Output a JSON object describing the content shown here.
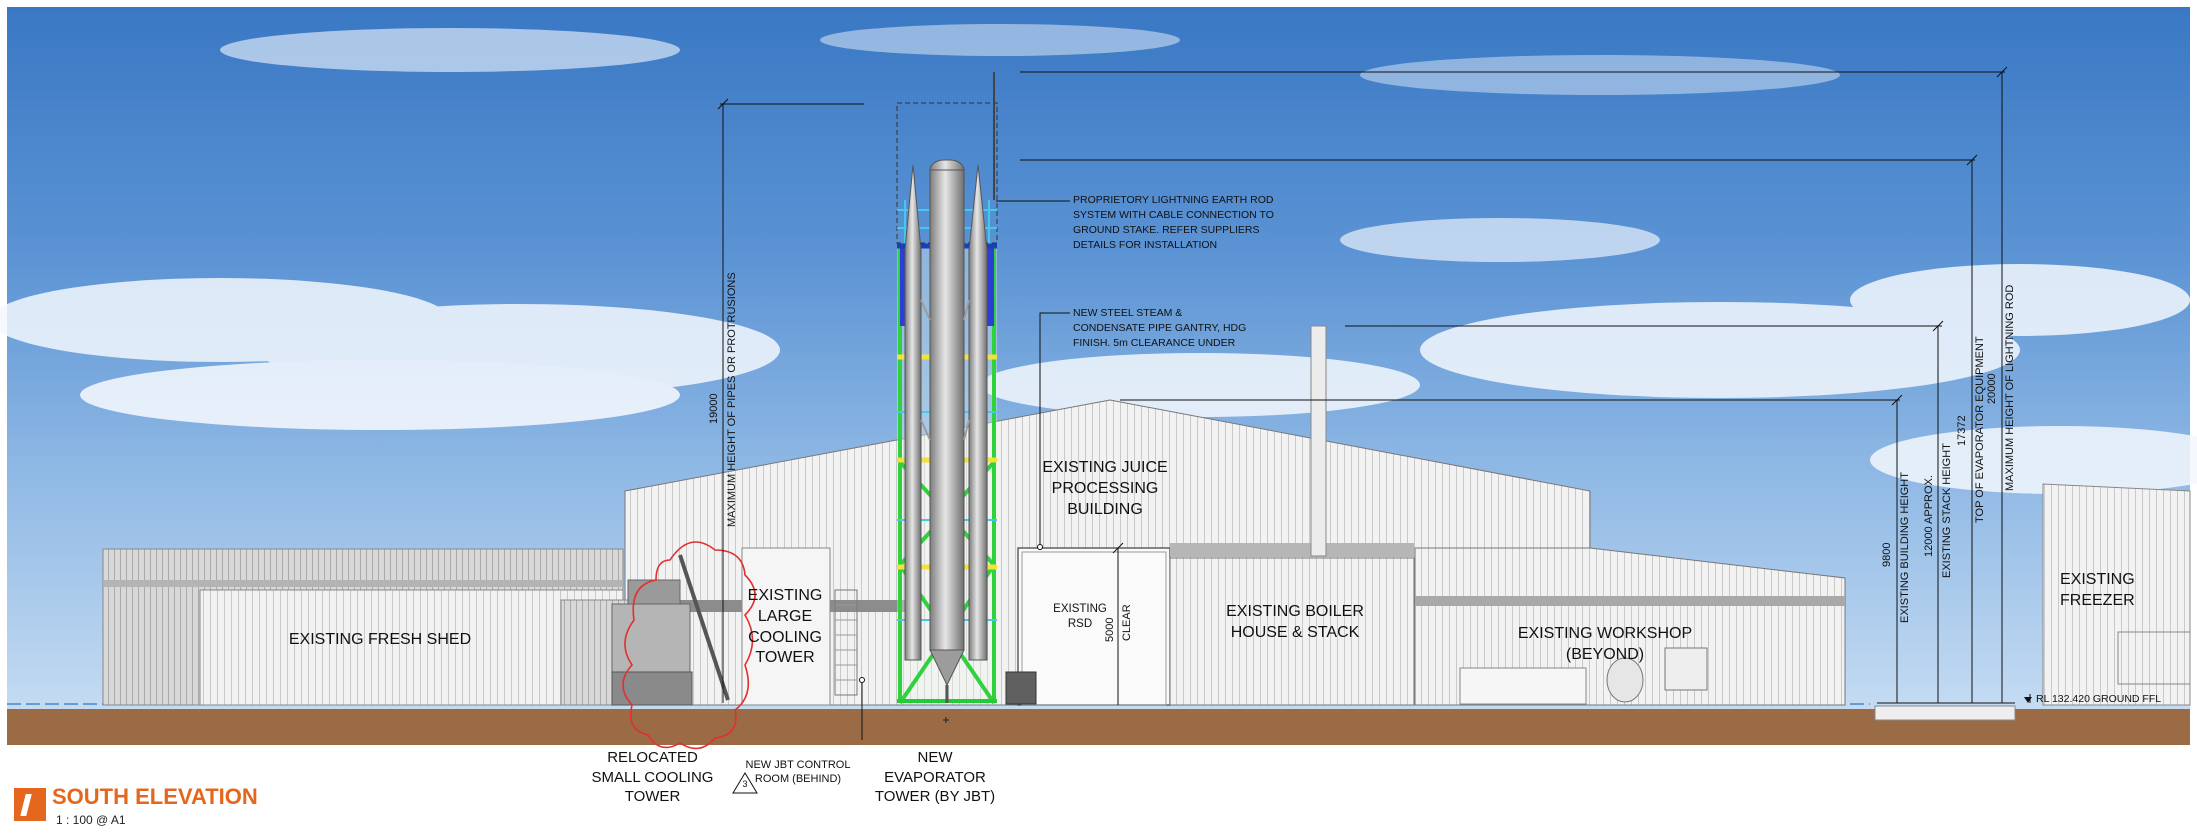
{
  "drawing": {
    "title": "SOUTH ELEVATION",
    "scale": "1 : 100 @ A1",
    "accent_color": "#e4671d",
    "sky_color": "#5b93d4",
    "ground_color": "#9a6b44"
  },
  "buildings": {
    "fresh_shed": "EXISTING FRESH SHED",
    "cooling_tower": "EXISTING\nLARGE\nCOOLING\nTOWER",
    "juice_building": "EXISTING JUICE\nPROCESSING\nBUILDING",
    "rsd": "EXISTING\nRSD",
    "boiler": "EXISTING BOILER\nHOUSE & STACK",
    "workshop": "EXISTING WORKSHOP (BEYOND)",
    "freezer": "EXISTING\nFREEZER"
  },
  "notes": {
    "lightning_rod": "PROPRIETORY LIGHTNING EARTH ROD\nSYSTEM WITH CABLE CONNECTION TO\nGROUND STAKE. REFER SUPPLIERS\nDETAILS FOR INSTALLATION",
    "steam_gantry": "NEW STEEL STEAM &\nCONDENSATE PIPE GANTRY, HDG\nFINISH. 5m CLEARANCE UNDER",
    "relocated_tower": "RELOCATED\nSMALL COOLING\nTOWER",
    "control_room": "NEW JBT CONTROL\nROOM (BEHIND)",
    "control_room_tag": "3",
    "new_tower": "NEW\nEVAPORATOR\nTOWER (BY JBT)",
    "ground_level": "RL 132.420 GROUND FFL"
  },
  "dimensions": {
    "max_protrusion_value": "19000",
    "max_protrusion_label": "MAXIMUM HEIGHT OF PIPES OR PROTRUSIONS",
    "clearance_value": "5000",
    "clearance_label": "CLEAR",
    "building_height_value": "9800",
    "building_height_label": "EXISTING BUILDING HEIGHT",
    "stack_height_value": "12000 APPROX.",
    "stack_height_label": "EXISTING STACK HEIGHT",
    "evaporator_value": "17372",
    "evaporator_label": "TOP OF EVAPORATOR EQUIPMENT",
    "lightning_value": "20000",
    "lightning_label": "MAXIMUM HEIGHT OF LIGHTNING ROD"
  }
}
